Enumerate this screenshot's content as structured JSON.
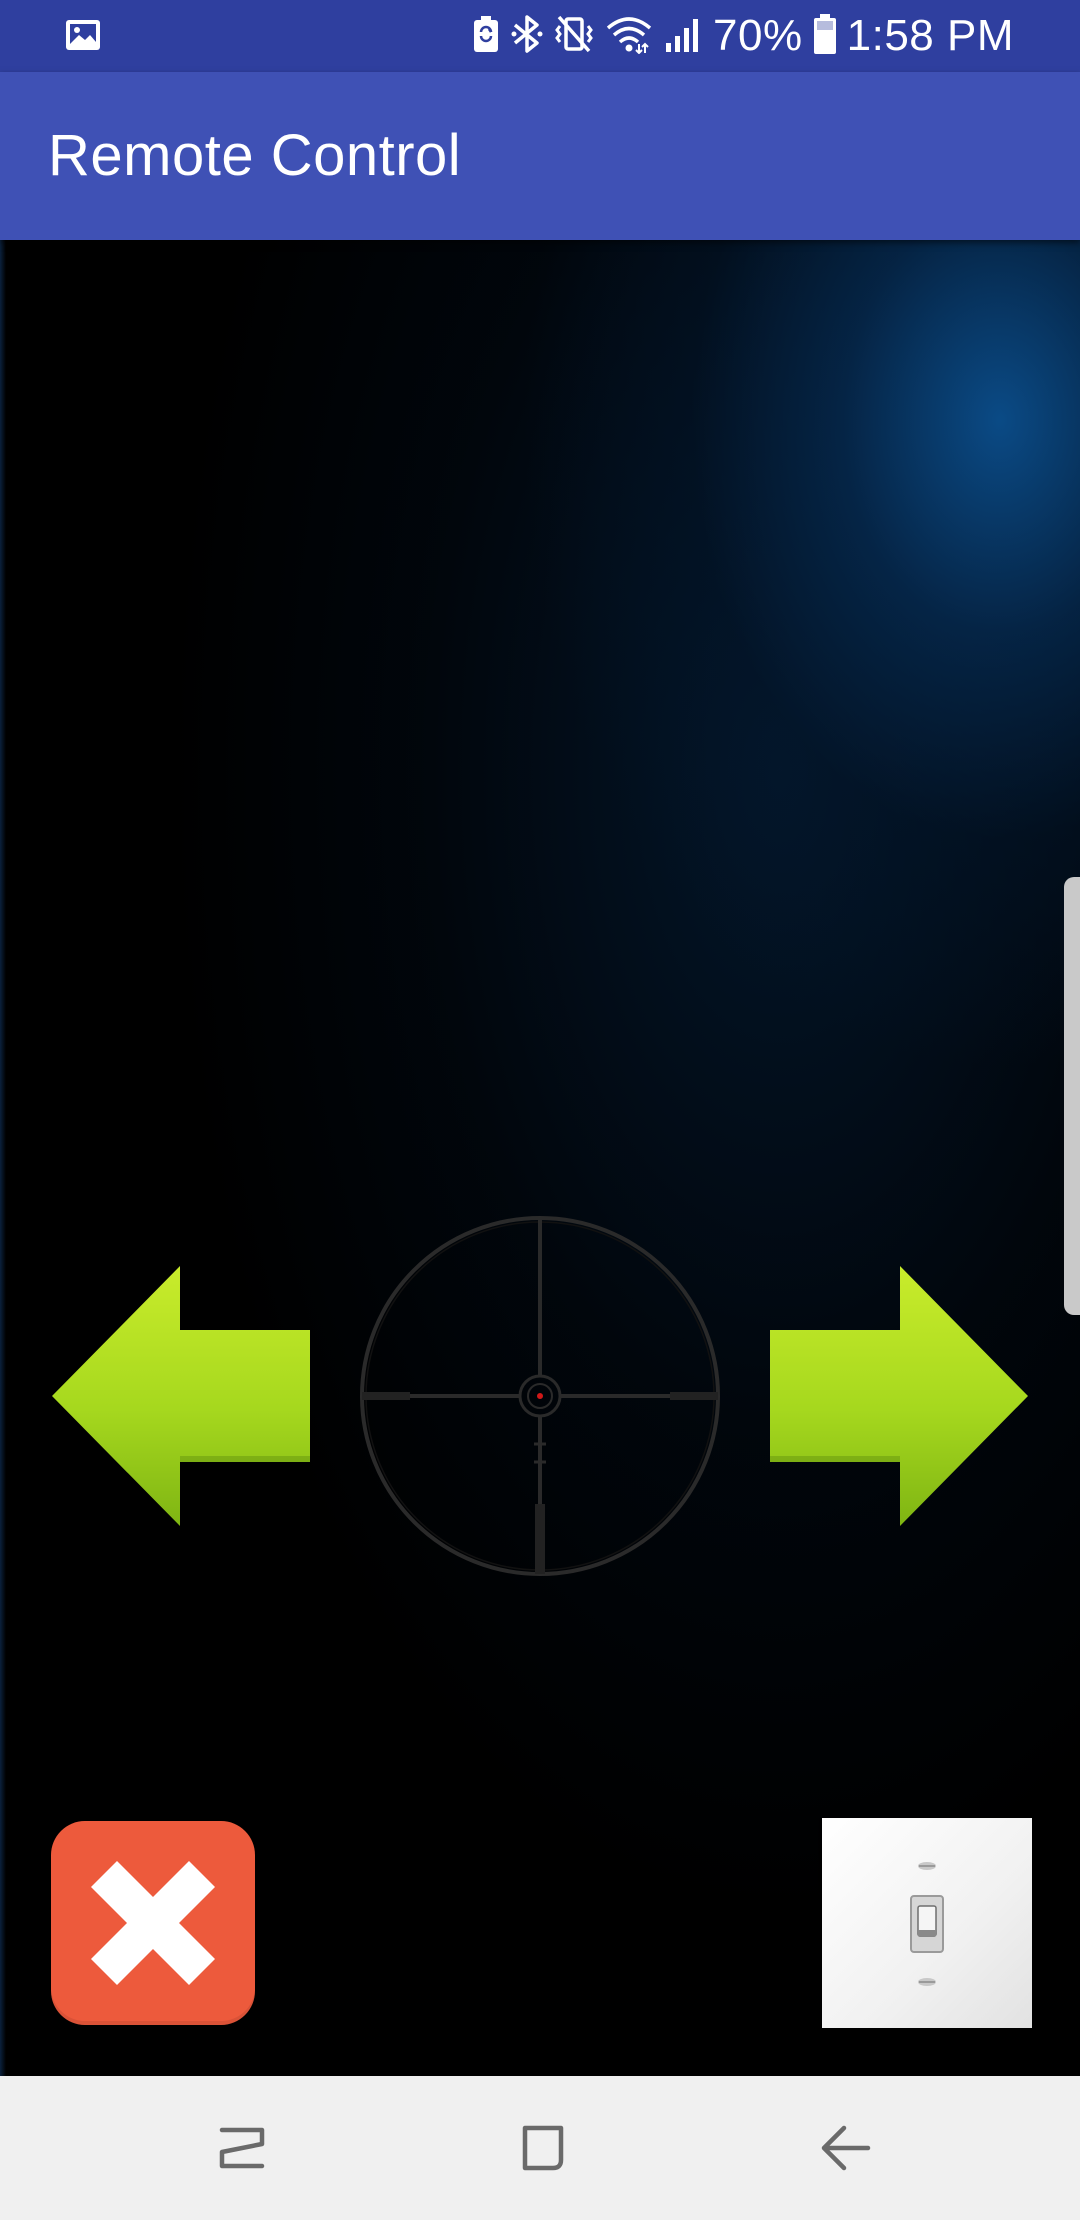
{
  "status_bar": {
    "battery_percent_text": "70%",
    "time": "1:58 PM",
    "icons": [
      "gallery-notification-icon",
      "battery-saver-icon",
      "bluetooth-icon",
      "vibrate-mute-icon",
      "wifi-icon",
      "signal-icon",
      "battery-icon"
    ]
  },
  "app_bar": {
    "title": "Remote Control",
    "color": "#3f51b5",
    "status_color": "#2f3f9f"
  },
  "controls": {
    "left_arrow_icon": "arrow-left-icon",
    "right_arrow_icon": "arrow-right-icon",
    "crosshair_icon": "crosshair-icon",
    "stop_icon": "close-x-icon",
    "switch_icon": "toggle-switch-icon",
    "arrow_color": "#a6d81e",
    "stop_color": "#ed5a3c"
  },
  "nav_bar": {
    "items": [
      "recents-icon",
      "home-icon",
      "back-icon"
    ]
  }
}
